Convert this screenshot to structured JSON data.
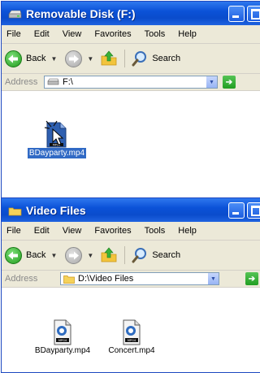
{
  "window1": {
    "title": "Removable Disk (F:)",
    "menu": [
      "File",
      "Edit",
      "View",
      "Favorites",
      "Tools",
      "Help"
    ],
    "toolbar": {
      "back": "Back",
      "search": "Search"
    },
    "address": {
      "label": "Address",
      "value": "F:\\"
    },
    "files": [
      {
        "name": "BDayparty.mp4",
        "selected": true,
        "icon": "mp4-file-icon"
      }
    ]
  },
  "window2": {
    "title": "Video Files",
    "menu": [
      "File",
      "Edit",
      "View",
      "Favorites",
      "Tools",
      "Help"
    ],
    "toolbar": {
      "back": "Back",
      "search": "Search"
    },
    "address": {
      "label": "Address",
      "value": "D:\\Video Files"
    },
    "files": [
      {
        "name": "BDayparty.mp4",
        "icon": "mp4-file-icon"
      },
      {
        "name": "Concert.mp4",
        "icon": "mp4-file-icon"
      }
    ]
  },
  "icons": {
    "file_badge": "MPG4"
  },
  "colors": {
    "title_blue": "#0b52d8",
    "selection": "#316ac5",
    "chrome": "#ece9d8"
  }
}
